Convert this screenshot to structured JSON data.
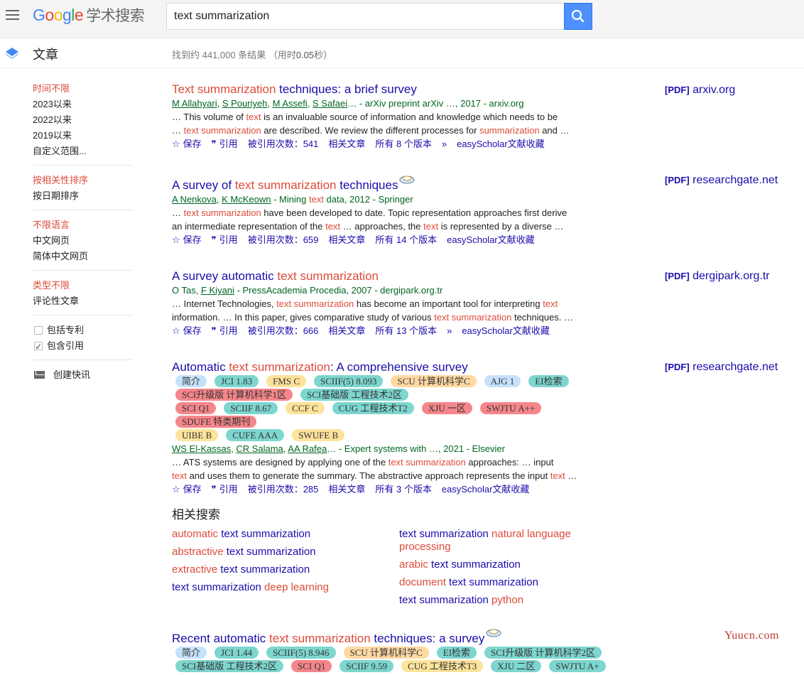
{
  "header": {
    "logo_letters": [
      {
        "ch": "G",
        "color": "#4285f4"
      },
      {
        "ch": "o",
        "color": "#ea4335"
      },
      {
        "ch": "o",
        "color": "#fbbc05"
      },
      {
        "ch": "g",
        "color": "#4285f4"
      },
      {
        "ch": "l",
        "color": "#34a853"
      },
      {
        "ch": "e",
        "color": "#ea4335"
      }
    ],
    "logo_suffix": "学术搜索",
    "search_value": "text summarization"
  },
  "subheader": {
    "section_label": "文章",
    "stats_prefix": "找到约 441,000 条结果 （用时",
    "stats_time": "0.05",
    "stats_suffix": "秒）"
  },
  "sidebar": {
    "time": [
      "时间不限",
      "2023以来",
      "2022以来",
      "2019以来",
      "自定义范围..."
    ],
    "sort": [
      "按相关性排序",
      "按日期排序"
    ],
    "lang": [
      "不限语言",
      "中文网页",
      "简体中文网页"
    ],
    "type": [
      "类型不限",
      "评论性文章"
    ],
    "include_patents": "包括专利",
    "include_citations": "包含引用",
    "create_alert": "创建快讯"
  },
  "actions": {
    "save": "保存",
    "cite": "引用",
    "related": "相关文章",
    "easyscholar": "easyScholar文献收藏"
  },
  "results": [
    {
      "title": [
        {
          "t": "Text summarization",
          "h": true
        },
        {
          "t": " techniques: a brief survey",
          "h": false
        }
      ],
      "authors": [
        {
          "t": "M Allahyari",
          "u": true
        },
        {
          "t": ", ",
          "u": false
        },
        {
          "t": "S Pouriyeh",
          "u": true
        },
        {
          "t": ", ",
          "u": false
        },
        {
          "t": "M Assefi",
          "u": true
        },
        {
          "t": ", ",
          "u": false
        },
        {
          "t": "S Safaei",
          "u": true
        },
        {
          "t": "… - arXiv preprint arXiv …, 2017 - arxiv.org",
          "u": false
        }
      ],
      "snippet": [
        [
          {
            "t": "… This volume of ",
            "h": false
          },
          {
            "t": "text",
            "h": true
          },
          {
            "t": " is an invaluable source of information and knowledge which needs to be",
            "h": false
          }
        ],
        [
          {
            "t": "… ",
            "h": false
          },
          {
            "t": "text summarization",
            "h": true
          },
          {
            "t": " are described. We review the different processes for ",
            "h": false
          },
          {
            "t": "summarization",
            "h": true
          },
          {
            "t": " and …",
            "h": false
          }
        ]
      ],
      "cited": "被引用次数：541",
      "versions": "所有 8 个版本",
      "pdf_tag": "[PDF]",
      "pdf_source": "arxiv.org"
    },
    {
      "title": [
        {
          "t": "A survey of ",
          "h": false
        },
        {
          "t": "text summarization",
          "h": true
        },
        {
          "t": " techniques",
          "h": false
        }
      ],
      "authors": [
        {
          "t": "A Nenkova",
          "u": true
        },
        {
          "t": ", ",
          "u": false
        },
        {
          "t": "K McKeown",
          "u": true
        },
        {
          "t": " - Mining ",
          "u": false
        },
        {
          "t": "text",
          "u": false,
          "h": true
        },
        {
          "t": " data, 2012 - Springer",
          "u": false
        }
      ],
      "snippet": [
        [
          {
            "t": "… ",
            "h": false
          },
          {
            "t": "text summarization",
            "h": true
          },
          {
            "t": " have been developed to date. Topic representation approaches first derive",
            "h": false
          }
        ],
        [
          {
            "t": "an intermediate representation of the ",
            "h": false
          },
          {
            "t": "text",
            "h": true
          },
          {
            "t": " … approaches, the ",
            "h": false
          },
          {
            "t": "text",
            "h": true
          },
          {
            "t": " is represented by a diverse …",
            "h": false
          }
        ]
      ],
      "cited": "被引用次数：659",
      "versions": "所有 14 个版本",
      "pdf_tag": "[PDF]",
      "pdf_source": "researchgate.net"
    },
    {
      "title": [
        {
          "t": "A survey automatic ",
          "h": false
        },
        {
          "t": "text summarization",
          "h": true
        }
      ],
      "authors": [
        {
          "t": "O Tas",
          "u": false
        },
        {
          "t": ", ",
          "u": false
        },
        {
          "t": "F Kiyani",
          "u": true
        },
        {
          "t": " - PressAcademia Procedia, 2007 - dergipark.org.tr",
          "u": false
        }
      ],
      "snippet": [
        [
          {
            "t": "… Internet Technologies, ",
            "h": false
          },
          {
            "t": "text summarization",
            "h": true
          },
          {
            "t": " has become an important tool for interpreting ",
            "h": false
          },
          {
            "t": "text",
            "h": true
          }
        ],
        [
          {
            "t": "information. … In this paper, gives comparative study of various ",
            "h": false
          },
          {
            "t": "text summarization",
            "h": true
          },
          {
            "t": " techniques. …",
            "h": false
          }
        ]
      ],
      "cited": "被引用次数：666",
      "versions": "所有 13 个版本",
      "pdf_tag": "[PDF]",
      "pdf_source": "dergipark.org.tr"
    },
    {
      "title": [
        {
          "t": "Automatic ",
          "h": false
        },
        {
          "t": "text summarization",
          "h": true
        },
        {
          "t": ": A comprehensive survey",
          "h": false
        }
      ],
      "tag_rows": [
        [
          {
            "t": "简介",
            "c": "blue"
          },
          {
            "t": "JCI 1.83",
            "c": "teal"
          },
          {
            "t": "FMS C",
            "c": "yellow"
          },
          {
            "t": "SCIIF(5) 8.093",
            "c": "teal"
          },
          {
            "t": "SCU 计算机科学C",
            "c": "orange"
          },
          {
            "t": "AJG 1",
            "c": "blue"
          },
          {
            "t": "EI检索",
            "c": "teal"
          }
        ],
        [
          {
            "t": "SCI升级版 计算机科学1区",
            "c": "red"
          },
          {
            "t": "SCI基础版 工程技术2区",
            "c": "teal"
          }
        ],
        [
          {
            "t": "SCI Q1",
            "c": "red"
          },
          {
            "t": "SCIIF 8.67",
            "c": "teal"
          },
          {
            "t": "CCF C",
            "c": "yellow"
          },
          {
            "t": "CUG 工程技术T2",
            "c": "teal"
          },
          {
            "t": "XJU 一区",
            "c": "red"
          },
          {
            "t": "SWJTU A++",
            "c": "red"
          },
          {
            "t": "SDUFE 特类期刊",
            "c": "red"
          }
        ],
        [
          {
            "t": "UIBE B",
            "c": "yellow"
          },
          {
            "t": "CUFE AAA",
            "c": "teal"
          },
          {
            "t": "SWUFE B",
            "c": "yellow"
          }
        ]
      ],
      "authors": [
        {
          "t": "WS El-Kassas",
          "u": true
        },
        {
          "t": ", ",
          "u": false
        },
        {
          "t": "CR Salama",
          "u": true
        },
        {
          "t": ", ",
          "u": false
        },
        {
          "t": "AA Rafea",
          "u": true
        },
        {
          "t": "… - Expert systems with …, 2021 - Elsevier",
          "u": false
        }
      ],
      "snippet": [
        [
          {
            "t": "… ATS systems are designed by applying one of the ",
            "h": false
          },
          {
            "t": "text summarization",
            "h": true
          },
          {
            "t": " approaches: … input",
            "h": false
          }
        ],
        [
          {
            "t": "text",
            "h": true
          },
          {
            "t": " and uses them to generate the summary. The abstractive approach represents the input ",
            "h": false
          },
          {
            "t": "text",
            "h": true
          },
          {
            "t": " …",
            "h": false
          }
        ]
      ],
      "cited": "被引用次数：285",
      "versions": "所有 3 个版本",
      "pdf_tag": "[PDF]",
      "pdf_source": "researchgate.net"
    },
    {
      "title": [
        {
          "t": "Recent automatic ",
          "h": false
        },
        {
          "t": "text summarization",
          "h": true
        },
        {
          "t": " techniques: a survey",
          "h": false
        }
      ],
      "tag_rows": [
        [
          {
            "t": "简介",
            "c": "blue"
          },
          {
            "t": "JCI 1.44",
            "c": "teal"
          },
          {
            "t": "SCIIF(5) 8.946",
            "c": "teal"
          },
          {
            "t": "SCU 计算机科学C",
            "c": "orange"
          },
          {
            "t": "EI检索",
            "c": "teal"
          },
          {
            "t": "SCI升级版 计算机科学2区",
            "c": "teal"
          }
        ],
        [
          {
            "t": "SCI基础版 工程技术2区",
            "c": "teal"
          },
          {
            "t": "SCI Q1",
            "c": "red"
          },
          {
            "t": "SCIIF 9.59",
            "c": "teal"
          },
          {
            "t": "CUG 工程技术T3",
            "c": "yellow"
          },
          {
            "t": "XJU 二区",
            "c": "teal"
          },
          {
            "t": "SWJTU A+",
            "c": "teal"
          }
        ]
      ]
    }
  ],
  "related": {
    "title": "相关搜索",
    "left": [
      [
        {
          "t": "automatic",
          "h": true
        },
        {
          "t": " text summarization",
          "h": false
        }
      ],
      [
        {
          "t": "abstractive",
          "h": true
        },
        {
          "t": " text summarization",
          "h": false
        }
      ],
      [
        {
          "t": "extractive",
          "h": true
        },
        {
          "t": " text summarization",
          "h": false
        }
      ],
      [
        {
          "t": "text summarization ",
          "h": false
        },
        {
          "t": "deep learning",
          "h": true
        }
      ]
    ],
    "right": [
      [
        {
          "t": "text summarization ",
          "h": false
        },
        {
          "t": "natural language processing",
          "h": true
        }
      ],
      [
        {
          "t": "arabic",
          "h": true
        },
        {
          "t": " text summarization",
          "h": false
        }
      ],
      [
        {
          "t": "document",
          "h": true
        },
        {
          "t": " text summarization",
          "h": false
        }
      ],
      [
        {
          "t": "text summarization ",
          "h": false
        },
        {
          "t": "python",
          "h": true
        }
      ]
    ]
  },
  "watermark": "Yuucn.com"
}
